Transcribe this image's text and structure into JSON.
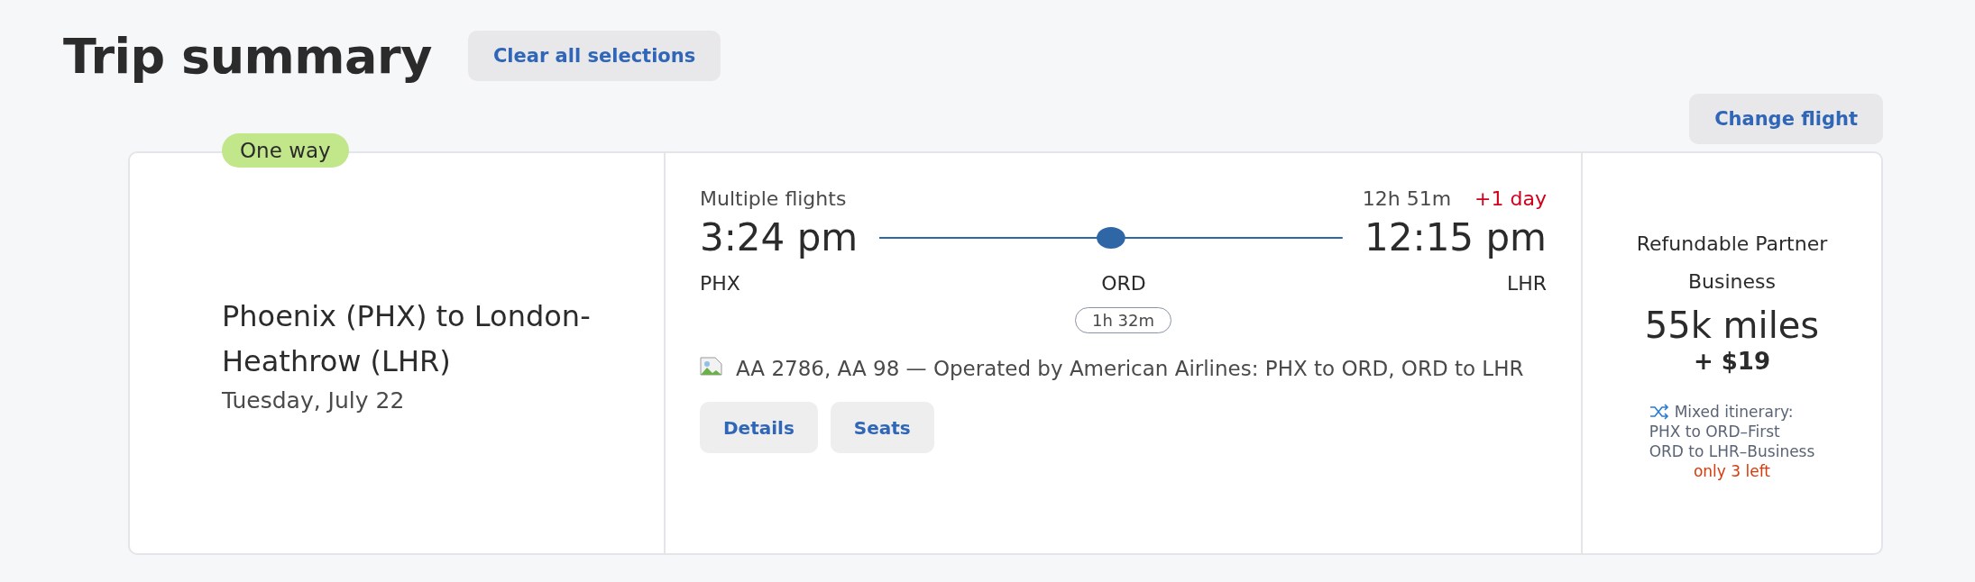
{
  "header": {
    "title": "Trip summary",
    "clear_button": "Clear all selections"
  },
  "change_button": "Change flight",
  "trip": {
    "badge": "One way",
    "route": "Phoenix (PHX) to London-Heathrow (LHR)",
    "date": "Tuesday, July 22"
  },
  "flight": {
    "type": "Multiple flights",
    "duration": "12h 51m",
    "day_offset": "+1 day",
    "depart_time": "3:24 pm",
    "arrive_time": "12:15 pm",
    "stops": [
      {
        "code": "PHX"
      },
      {
        "code": "ORD",
        "layover": "1h 32m"
      },
      {
        "code": "LHR"
      }
    ],
    "operated": "AA 2786, AA 98 — Operated by American Airlines: PHX to ORD, ORD to LHR",
    "buttons": [
      "Details",
      "Seats"
    ]
  },
  "fare": {
    "name": "Refundable Partner Business",
    "miles": "55k miles",
    "cash": "+ $19",
    "mixed_label": "Mixed itinerary:",
    "segments": [
      "PHX to ORD–First",
      "ORD to LHR–Business"
    ],
    "availability": "only 3 left"
  }
}
